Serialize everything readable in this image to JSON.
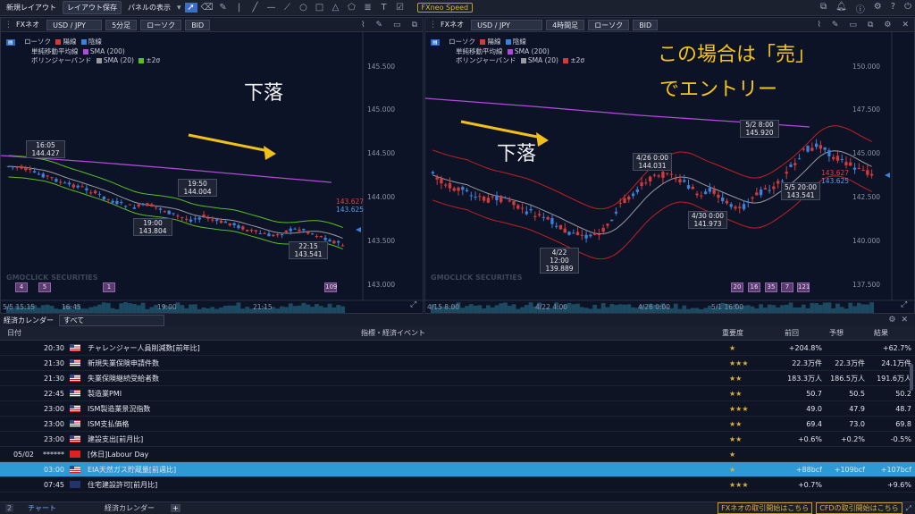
{
  "toolbar": {
    "new_layout": "新規レイアウト",
    "save_layout": "レイアウト保存",
    "panel_display": "パネルの表示",
    "speed": "FXneo Speed",
    "tools": [
      "cursor-tool",
      "eraser-tool",
      "pen-tool",
      "vertical-line-tool",
      "trend-line-tool",
      "horizontal-line-tool",
      "ray-tool",
      "circle-tool",
      "rectangle-tool",
      "triangle-tool",
      "pentagon-tool",
      "fib-tool",
      "text-tool",
      "checkbox-tool"
    ]
  },
  "colors": {
    "up": "#3d7fd9",
    "down": "#d23b3b",
    "sma200": "#b04ad8",
    "sma20": "#9a9aa0",
    "band": "#58c020",
    "band_right": "#c02020",
    "note": "#f2c01a"
  },
  "chart1": {
    "product": "FXネオ",
    "pair": "USD / JPY",
    "timeframe": "5分足",
    "chart_type": "ローソク",
    "side": "BID",
    "legend": {
      "candle": "ローソク",
      "yang": "陽線",
      "yin": "陰線",
      "sma_label": "単純移動平均線",
      "sma_value": "SMA (200)",
      "bb_label": "ボリンジャーバンド",
      "bb_sma": "SMA (20)",
      "bb_sigma": "±2σ"
    },
    "annotation": "下落",
    "y_ticks": [
      "145.500",
      "145.000",
      "144.500",
      "144.000",
      "143.500",
      "143.000"
    ],
    "x_ticks": [
      "5/5 15:15",
      "16:45",
      "19:00",
      "21:15"
    ],
    "labels": [
      {
        "time": "16:05",
        "price": "144.427"
      },
      {
        "time": "19:50",
        "price": "144.004"
      },
      {
        "time": "19:00",
        "price": "143.804"
      },
      {
        "time": "22:15",
        "price": "143.541"
      }
    ],
    "price_red": "143.627",
    "price_blue": "143.625",
    "badges": [
      "4",
      "5",
      "1",
      "109"
    ],
    "watermark": "GMOCLICK SECURITIES"
  },
  "chart2": {
    "product": "FXネオ",
    "pair": "USD / JPY",
    "timeframe": "4時間足",
    "chart_type": "ローソク",
    "side": "BID",
    "legend": {
      "candle": "ローソク",
      "yang": "陽線",
      "yin": "陰線",
      "sma_label": "単純移動平均線",
      "sma_value": "SMA (200)",
      "bb_label": "ボリンジャーバンド",
      "bb_sma": "SMA (20)",
      "bb_sigma": "±2σ"
    },
    "annotation": "下落",
    "note_line1": "この場合は「売」",
    "note_line2": "でエントリー",
    "y_ticks": [
      "150.000",
      "147.500",
      "145.000",
      "142.500",
      "140.000",
      "137.500"
    ],
    "x_ticks": [
      "4/15 8:00",
      "4/22 4:00",
      "4/26 0:00",
      "5/1 16:00"
    ],
    "labels": [
      {
        "time": "5/2 8:00",
        "price": "145.920"
      },
      {
        "time": "4/26 0:00",
        "price": "144.031"
      },
      {
        "time": "4/30 0:00",
        "price": "141.973"
      },
      {
        "time": "4/22 12:00",
        "price": "139.889"
      },
      {
        "time": "5/5 20:00",
        "price": "143.541"
      }
    ],
    "price_red": "143.627",
    "price_blue": "143.625",
    "badges": [
      "20",
      "16",
      "35",
      "7",
      "121"
    ],
    "watermark": "GMOCLICK SECURITIES"
  },
  "calendar": {
    "title": "経済カレンダー",
    "filter": "すべて",
    "columns": {
      "date": "日付",
      "event": "指標・経済イベント",
      "importance": "重要度",
      "previous": "前回",
      "forecast": "予想",
      "result": "結果"
    },
    "rows": [
      {
        "date": "",
        "time": "20:30",
        "flag": "us",
        "event": "チャレンジャー人員削減数[前年比]",
        "imp": "★",
        "prev": "+204.8%",
        "fc": "",
        "res": "+62.7%",
        "hl": false
      },
      {
        "date": "",
        "time": "21:30",
        "flag": "us",
        "event": "新規失業保険申請件数",
        "imp": "★★★",
        "prev": "22.3万件",
        "fc": "22.3万件",
        "res": "24.1万件",
        "hl": false
      },
      {
        "date": "",
        "time": "21:30",
        "flag": "us",
        "event": "失業保険継続受給者数",
        "imp": "★★",
        "prev": "183.3万人",
        "fc": "186.5万人",
        "res": "191.6万人",
        "hl": false
      },
      {
        "date": "",
        "time": "22:45",
        "flag": "us",
        "event": "製造業PMI",
        "imp": "★★",
        "prev": "50.7",
        "fc": "50.5",
        "res": "50.2",
        "hl": false
      },
      {
        "date": "",
        "time": "23:00",
        "flag": "us",
        "event": "ISM製造業景況指数",
        "imp": "★★★",
        "prev": "49.0",
        "fc": "47.9",
        "res": "48.7",
        "hl": false
      },
      {
        "date": "",
        "time": "23:00",
        "flag": "us",
        "event": "ISM支払価格",
        "imp": "★★",
        "prev": "69.4",
        "fc": "73.0",
        "res": "69.8",
        "hl": false
      },
      {
        "date": "",
        "time": "23:00",
        "flag": "us",
        "event": "建設支出[前月比]",
        "imp": "★★",
        "prev": "+0.6%",
        "fc": "+0.2%",
        "res": "-0.5%",
        "hl": false
      },
      {
        "date": "05/02",
        "time": "******",
        "flag": "cn",
        "event": "[休日]Labour Day",
        "imp": "★",
        "prev": "",
        "fc": "",
        "res": "",
        "hl": false
      },
      {
        "date": "",
        "time": "03:00",
        "flag": "us",
        "event": "EIA天然ガス貯蔵量[前週比]",
        "imp": "★",
        "prev": "+88bcf",
        "fc": "+109bcf",
        "res": "+107bcf",
        "hl": true
      },
      {
        "date": "",
        "time": "07:45",
        "flag": "nz",
        "event": "住宅建設許可[前月比]",
        "imp": "★★★",
        "prev": "+0.7%",
        "fc": "",
        "res": "+9.6%",
        "hl": false
      }
    ]
  },
  "bottom": {
    "tab_chart": "チャート",
    "tab_calendar": "経済カレンダー",
    "fx_start": "FXネオの取引開始はこちら",
    "cfd_start": "CFDの取引開始はこちら"
  }
}
